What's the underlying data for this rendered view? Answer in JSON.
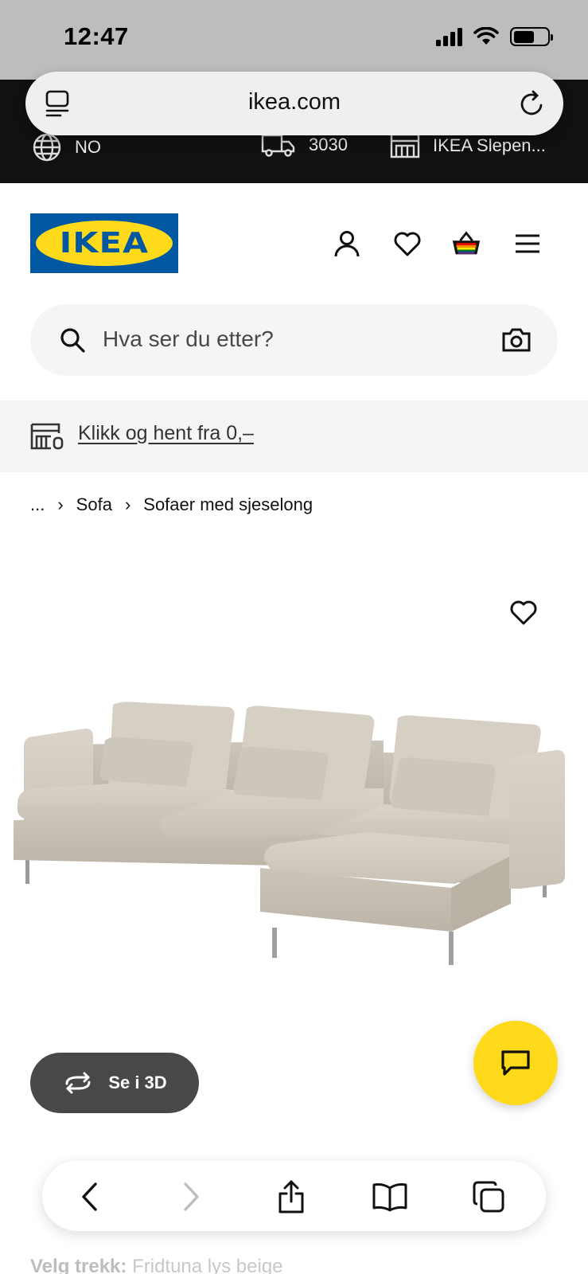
{
  "status_bar": {
    "time": "12:47"
  },
  "browser": {
    "url": "ikea.com"
  },
  "top_bar": {
    "country": "NO",
    "postal_code": "3030",
    "store": "IKEA Slepen..."
  },
  "header": {
    "logo_text": "IKEA",
    "icons": [
      "account-icon",
      "heart-icon",
      "cart-icon",
      "menu-icon"
    ]
  },
  "search": {
    "placeholder": "Hva ser du etter?"
  },
  "click_collect": {
    "text": "Klikk og hent fra 0,–"
  },
  "breadcrumb": {
    "ellipsis": "...",
    "items": [
      "Sofa",
      "Sofaer med sjeselong"
    ]
  },
  "product": {
    "view_3d_label": "Se i 3D",
    "select_cover_label": "Velg trekk:",
    "select_cover_value": "Fridtuna lys beige"
  },
  "colors": {
    "ikea_blue": "#0058a3",
    "ikea_yellow": "#ffda1a",
    "topbar_bg": "#111111"
  }
}
